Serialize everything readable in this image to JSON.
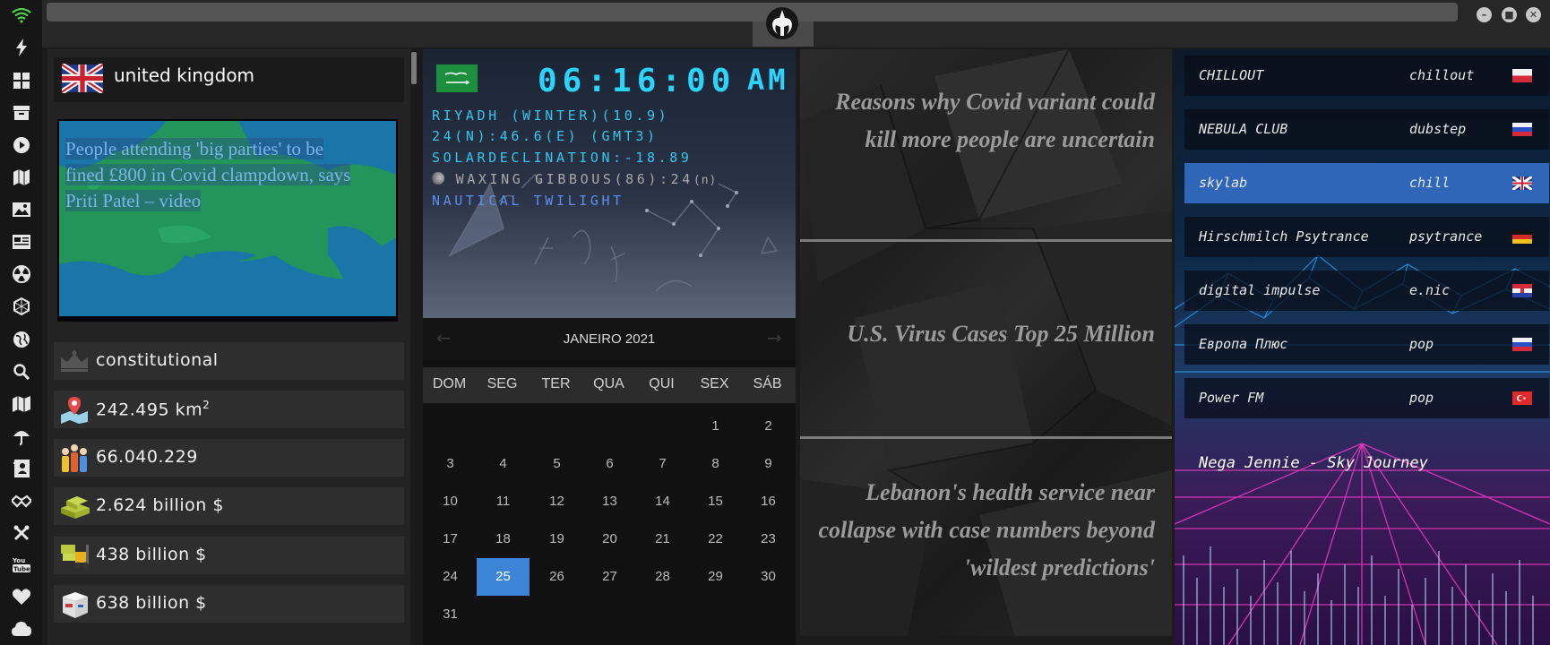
{
  "sidebar": {
    "icons": [
      "wifi-icon",
      "lightning-icon",
      "windows-icon",
      "archive-icon",
      "play-icon",
      "atlas-icon",
      "image-icon",
      "news-icon",
      "radiation-icon",
      "hexagon-icon",
      "globe-icon",
      "search-icon",
      "map-icon",
      "umbrella-icon",
      "contacts-icon",
      "handshake-icon",
      "tools-icon",
      "youtube-icon",
      "heart-icon",
      "cloud-icon"
    ]
  },
  "country": {
    "name": "united kingdom",
    "news_headline": "People attending 'big parties' to be fined £800 in Covid clampdown, says Priti Patel – video",
    "government": "constitutional",
    "area": "242.495 km",
    "area_sup": "2",
    "population": "66.040.229",
    "gdp": "2.624 billion $",
    "exports": "438 billion $",
    "imports": "638 billion $"
  },
  "clock": {
    "time": "06:16:00",
    "ampm": "AM",
    "location": "RIYADH (WINTER)(10.9)",
    "coords": "24(N):46.6(E) (GMT3)",
    "declination": "SOLARDECLINATION:-18.89",
    "moon": "WAXING GIBBOUS(86):24",
    "moon_suffix": "(n)",
    "twilight": "NAUTICAL TWILIGHT"
  },
  "calendar": {
    "month": "JANEIRO 2021",
    "weekdays": [
      "DOM",
      "SEG",
      "TER",
      "QUA",
      "QUI",
      "SEX",
      "SÁB"
    ],
    "selected_day": "25"
  },
  "news": {
    "items": [
      "Reasons why Covid variant could kill more people are uncertain",
      "U.S. Virus Cases Top 25 Million",
      "Lebanon's health service near collapse with case numbers beyond 'wildest predictions'"
    ]
  },
  "radio": {
    "stations": [
      {
        "name": "CHILLOUT",
        "genre": "chillout",
        "flag": "poland"
      },
      {
        "name": "NEBULA CLUB",
        "genre": "dubstep",
        "flag": "russia"
      },
      {
        "name": "skylab",
        "genre": "chill",
        "flag": "uk"
      },
      {
        "name": "Hirschmilch Psytrance",
        "genre": "psytrance",
        "flag": "germany"
      },
      {
        "name": "digital impulse",
        "genre": "e.nic",
        "flag": "croatia"
      },
      {
        "name": "Европа Плюс",
        "genre": "pop",
        "flag": "russia"
      },
      {
        "name": "Power FM",
        "genre": "pop",
        "flag": "turkey"
      }
    ],
    "now_playing": "Nega Jennie - Sky Journey"
  },
  "colors": {
    "accent_blue": "#3b84d8",
    "clock_cyan": "#2ad4ff",
    "map_green": "#1f8f4f"
  }
}
